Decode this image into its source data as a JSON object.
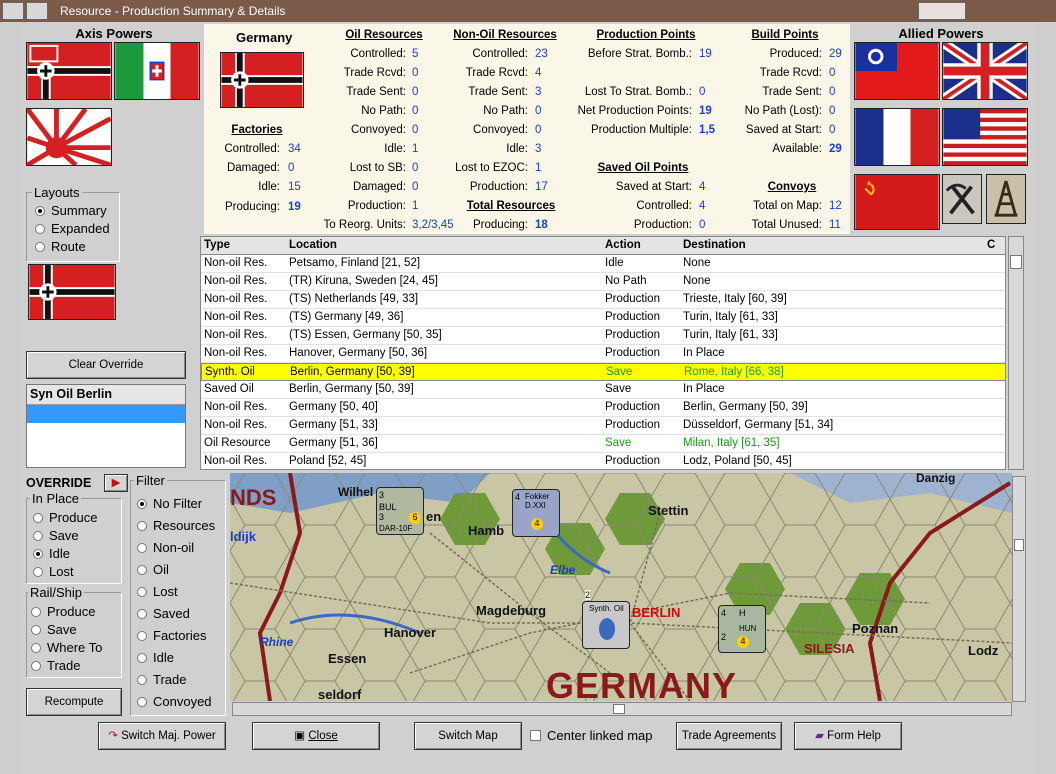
{
  "window": {
    "title": "Resource - Production Summary & Details"
  },
  "axis": {
    "title": "Axis Powers"
  },
  "allied": {
    "title": "Allied Powers"
  },
  "layouts": {
    "label": "Layouts",
    "options": [
      "Summary",
      "Expanded",
      "Route"
    ],
    "selected": "Summary"
  },
  "buttons": {
    "clear_override": "Clear Override",
    "recompute": "Recompute",
    "switch_major": "Switch Maj. Power",
    "close": "Close",
    "switch_map": "Switch Map",
    "center_linked": "Center linked map",
    "trade_agreements": "Trade Agreements",
    "form_help": "Form Help"
  },
  "selected_list": {
    "header": "Syn Oil Berlin"
  },
  "override": {
    "label": "OVERRIDE"
  },
  "in_place": {
    "label": "In Place",
    "options": [
      "Produce",
      "Save",
      "Idle",
      "Lost"
    ],
    "selected": "Idle"
  },
  "rail_ship": {
    "label": "Rail/Ship",
    "options": [
      "Produce",
      "Save",
      "Where To",
      "Trade"
    ]
  },
  "filter": {
    "label": "Filter",
    "options": [
      "No Filter",
      "Resources",
      "Non-oil",
      "Oil",
      "Lost",
      "Saved",
      "Factories",
      "Idle",
      "Trade",
      "Convoyed"
    ],
    "selected": "No Filter"
  },
  "summary": {
    "country": "Germany",
    "factories": {
      "title": "Factories",
      "rows": [
        [
          "Controlled:",
          "34"
        ],
        [
          "Damaged:",
          "0"
        ],
        [
          "Idle:",
          "15"
        ],
        [
          "Producing:",
          "19"
        ]
      ]
    },
    "oil": {
      "title": "Oil Resources",
      "rows": [
        [
          "Controlled:",
          "5"
        ],
        [
          "Trade Rcvd:",
          "0"
        ],
        [
          "Trade Sent:",
          "0"
        ],
        [
          "No Path:",
          "0"
        ],
        [
          "Convoyed:",
          "0"
        ],
        [
          "Idle:",
          "1"
        ],
        [
          "Lost to SB:",
          "0"
        ],
        [
          "Damaged:",
          "0"
        ],
        [
          "Production:",
          "1"
        ],
        [
          "To Reorg. Units:",
          "3,2/3,45"
        ]
      ]
    },
    "nonoil": {
      "title": "Non-Oil Resources",
      "rows": [
        [
          "Controlled:",
          "23"
        ],
        [
          "Trade Rcvd:",
          "4"
        ],
        [
          "Trade Sent:",
          "3"
        ],
        [
          "No Path:",
          "0"
        ],
        [
          "Convoyed:",
          "0"
        ],
        [
          "Idle:",
          "3"
        ],
        [
          "Lost to EZOC:",
          "1"
        ],
        [
          "Production:",
          "17"
        ]
      ]
    },
    "total": {
      "title": "Total Resources",
      "label": "Producing:",
      "value": "18"
    },
    "pp": {
      "title": "Production Points",
      "rows": [
        [
          "Before Strat. Bomb.:",
          "19"
        ],
        [
          "Lost To Strat. Bomb.:",
          "0"
        ],
        [
          "Net Production Points:",
          "19"
        ],
        [
          "Production Multiple:",
          "1,5"
        ]
      ]
    },
    "saved_oil": {
      "title": "Saved Oil Points",
      "rows": [
        [
          "Saved at Start:",
          "4"
        ],
        [
          "Controlled:",
          "4"
        ],
        [
          "Production:",
          "0"
        ]
      ]
    },
    "bp": {
      "title": "Build Points",
      "rows": [
        [
          "Produced:",
          "29"
        ],
        [
          "Trade Rcvd:",
          "0"
        ],
        [
          "Trade Sent:",
          "0"
        ],
        [
          "No Path (Lost):",
          "0"
        ],
        [
          "Saved at Start:",
          "0"
        ],
        [
          "Available:",
          "29"
        ]
      ]
    },
    "convoys": {
      "title": "Convoys",
      "rows": [
        [
          "Total on Map:",
          "12"
        ],
        [
          "Total Unused:",
          "11"
        ]
      ]
    }
  },
  "table": {
    "headers": [
      "Type",
      "Location",
      "Action",
      "Destination",
      "C"
    ],
    "rows": [
      [
        "Non-oil Res.",
        "Petsamo, Finland [21, 52]",
        "Idle",
        "None"
      ],
      [
        "Non-oil Res.",
        "(TR) Kiruna, Sweden [24, 45]",
        "No Path",
        "None"
      ],
      [
        "Non-oil Res.",
        "(TS) Netherlands [49, 33]",
        "Production",
        "Trieste, Italy [60, 39]"
      ],
      [
        "Non-oil Res.",
        "(TS) Germany [49, 36]",
        "Production",
        "Turin, Italy [61, 33]"
      ],
      [
        "Non-oil Res.",
        "(TS) Essen, Germany [50, 35]",
        "Production",
        "Turin, Italy [61, 33]"
      ],
      [
        "Non-oil Res.",
        "Hanover, Germany [50, 36]",
        "Production",
        "In Place"
      ],
      [
        "Synth. Oil",
        "Berlin, Germany [50, 39]",
        "Save",
        "Rome, Italy [66, 38]"
      ],
      [
        "Saved Oil",
        "Berlin, Germany [50, 39]",
        "Save",
        "In Place"
      ],
      [
        "Non-oil Res.",
        "Germany [50, 40]",
        "Production",
        "Berlin, Germany [50, 39]"
      ],
      [
        "Non-oil Res.",
        "Germany [51, 33]",
        "Production",
        "Düsseldorf, Germany [51, 34]"
      ],
      [
        "Oil Resource",
        "Germany [51, 36]",
        "Save",
        "Milan, Italy [61, 35]"
      ],
      [
        "Non-oil Res.",
        "Poland [52, 45]",
        "Production",
        "Lodz, Poland [50, 45]"
      ]
    ]
  },
  "map": {
    "labels": [
      "NDS",
      "Wilhel",
      "ldijk",
      "en",
      "Hamb",
      "Stettin",
      "Elbe",
      "Magdeburg",
      "Hanover",
      "Rhine",
      "Essen",
      "seldorf",
      "BERLIN",
      "Poznan",
      "SILESIA",
      "Lodz",
      "GERMANY",
      "Danzig"
    ],
    "counters": [
      {
        "top": "3",
        "mid": "BUL",
        "num": "6",
        "bot": "DAR-10F",
        "extra": "3"
      },
      {
        "top": "4",
        "mid": "Fokker D.XXI",
        "num": "4"
      },
      {
        "top": "2",
        "mid": "Synth. Oil"
      },
      {
        "top": "4",
        "mid": "H",
        "num": "4",
        "bot": "HUN",
        "extra": "2"
      }
    ]
  },
  "colors": {
    "table_highlight": "#ffff00",
    "value_blue": "#1b3fc0",
    "save_green": "#1a9a1a",
    "title_bar": "#7b5a4a"
  }
}
